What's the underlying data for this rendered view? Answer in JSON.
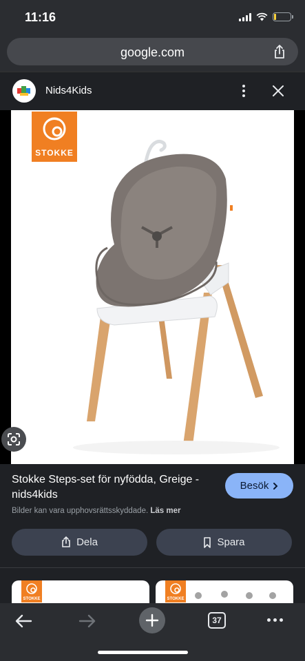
{
  "status": {
    "time": "11:16",
    "battery_level": 0.15,
    "battery_color": "#f9d23c"
  },
  "browser": {
    "url": "google.com"
  },
  "header": {
    "site_name": "Nids4Kids"
  },
  "image": {
    "brand_logo_text": "STOKKE",
    "description_icon": "stokke-logo"
  },
  "result": {
    "title": "Stokke Steps-set för nyfödda, Greige - nids4kids",
    "visit_label": "Besök",
    "copyright_text": "Bilder kan vara upphovsrättsskyddade.",
    "learn_more": "Läs mer",
    "share_label": "Dela",
    "save_label": "Spara"
  },
  "related": [
    {
      "logo_text": "STOKKE"
    },
    {
      "logo_text": "STOKKE"
    }
  ],
  "bottom_bar": {
    "tabs_count": "37"
  },
  "colors": {
    "accent": "#8ab4f8",
    "stokke_orange": "#f07f22",
    "background": "#1f2125"
  }
}
